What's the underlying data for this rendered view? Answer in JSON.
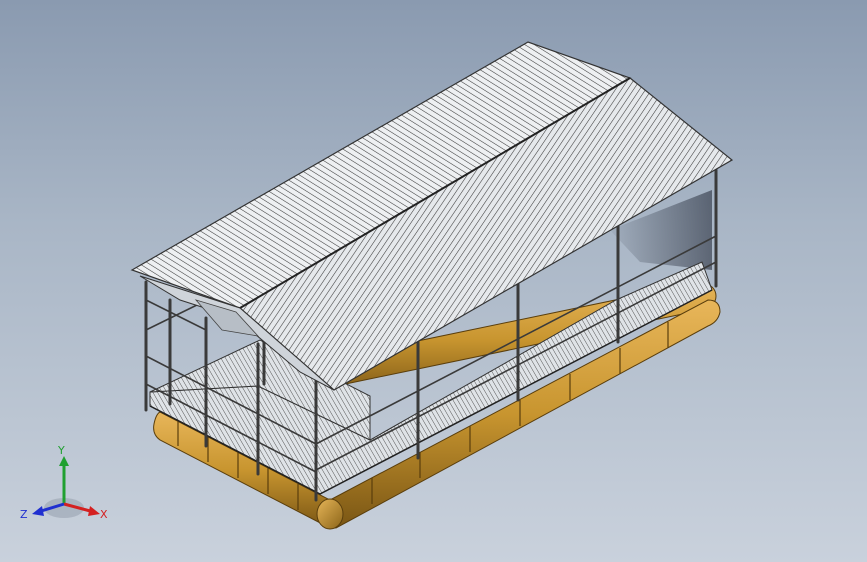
{
  "scene": {
    "model": "boat-shed-assembly",
    "background_top": "#8a9ab0",
    "background_bottom": "#c9d1dc",
    "pontoon_color": "#c8952f",
    "frame_color": "#444444",
    "roof_color": "#e9ecef"
  },
  "triad": {
    "x_label": "X",
    "y_label": "Y",
    "z_label": "Z",
    "x_color": "#d42020",
    "y_color": "#20a030",
    "z_color": "#2030d0"
  }
}
